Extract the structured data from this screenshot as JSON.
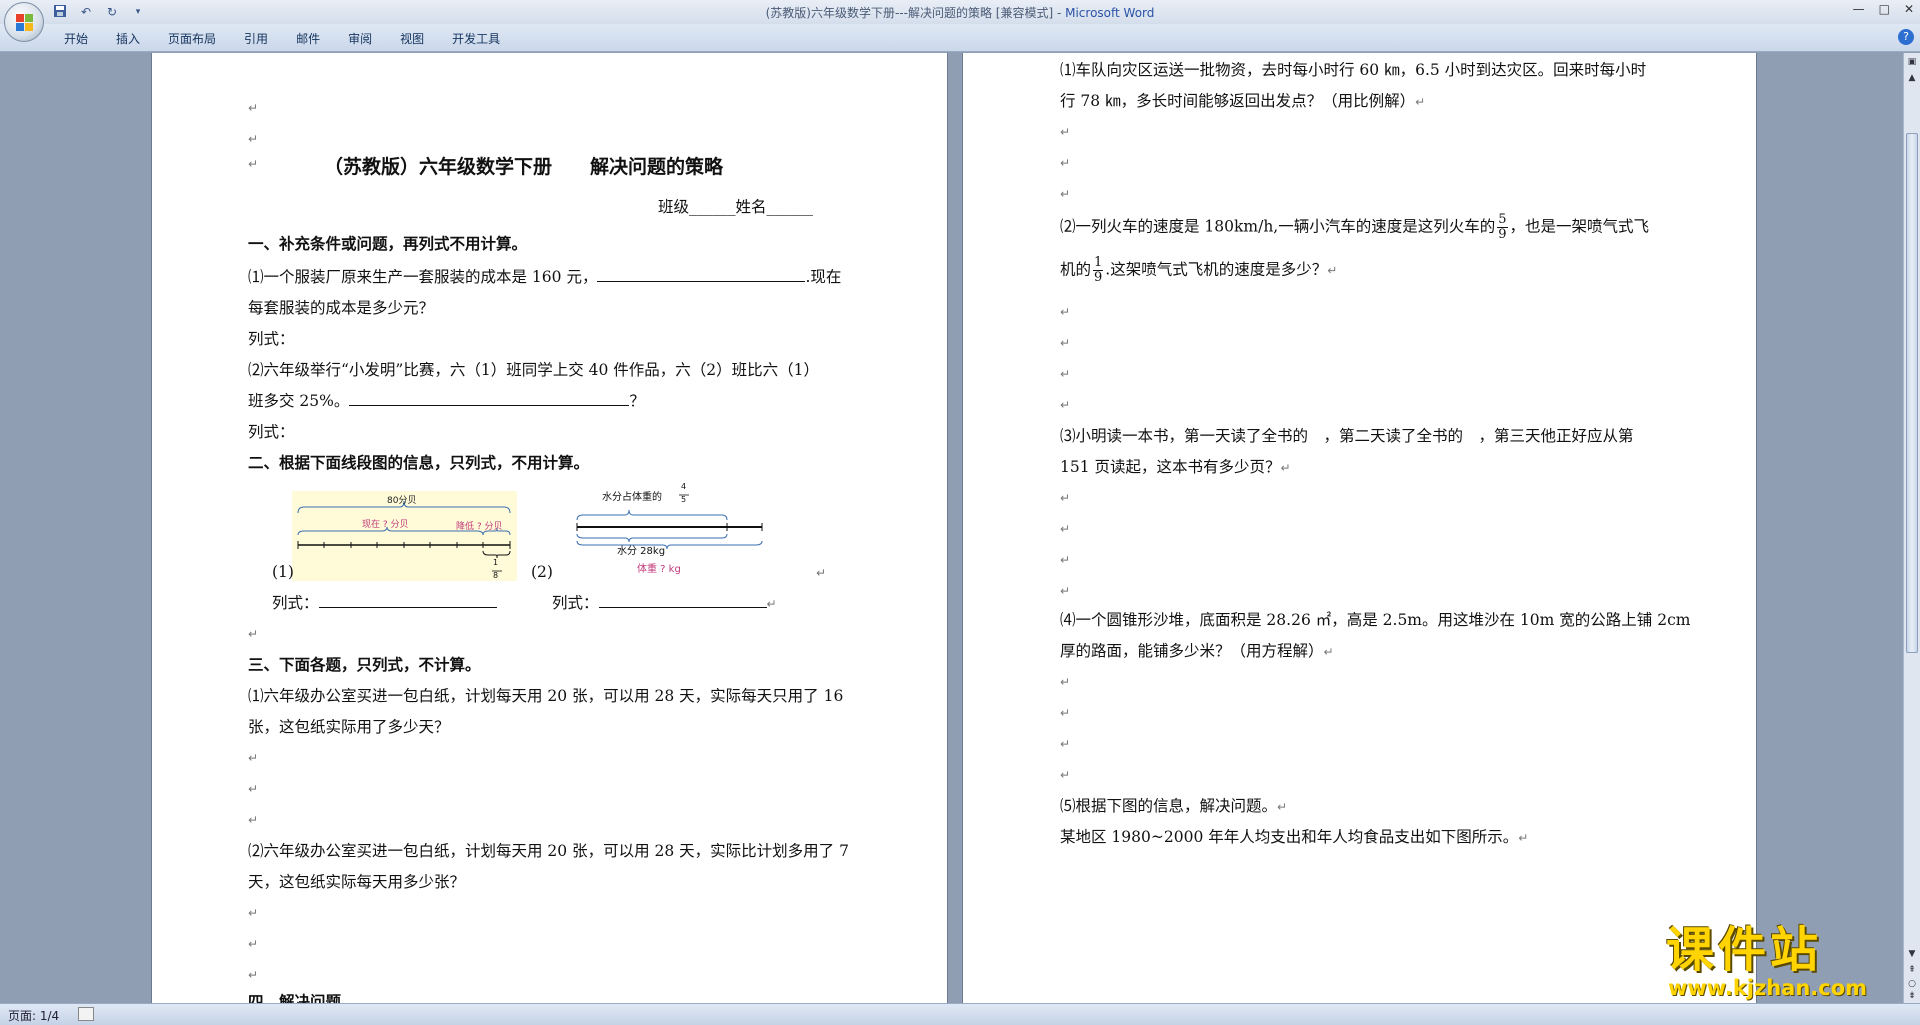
{
  "window": {
    "title_doc": "(苏教版)六年级数学下册---解决问题的策略 [兼容模式] - ",
    "title_app": "Microsoft Word"
  },
  "ribbon": {
    "tabs": [
      "开始",
      "插入",
      "页面布局",
      "引用",
      "邮件",
      "审阅",
      "视图",
      "开发工具"
    ]
  },
  "paragraph_mark": "↵",
  "left_page": {
    "title": "（苏教版）六年级数学下册　　解决问题的策略",
    "class_name_line": "班级______姓名______",
    "section1": "一、补充条件或问题，再列式不用计算。",
    "q1_1a": "⑴一个服装厂原来生产一套服装的成本是 160 元，",
    "q1_1b": ".现在",
    "q1_1c": "每套服装的成本是多少元？",
    "formula": "列式：",
    "q1_2a": "⑵六年级举行“小发明”比赛，六（1）班同学上交 40 件作品，六（2）班比六（1）",
    "q1_2b": "班多交 25%。",
    "q1_2c": "？",
    "section2": "二、根据下面线段图的信息，只列式，不用计算。",
    "fig1_label": "(1)",
    "fig2_label": "(2)",
    "fig1": {
      "top": "80分贝",
      "now": "现在 ? 分贝",
      "drop": "降低 ? 分贝",
      "frac_num": "1",
      "frac_den": "8"
    },
    "fig2": {
      "water_label": "水分占体重的",
      "frac_num": "4",
      "frac_den": "5",
      "water": "水分 28kg",
      "weight": "体重 ? kg"
    },
    "section3": "三、下面各题，只列式，不计算。",
    "q3_1a": "⑴六年级办公室买进一包白纸，计划每天用 20 张，可以用 28 天，实际每天只用了 16",
    "q3_1b": "张，这包纸实际用了多少天？",
    "q3_2a": "⑵六年级办公室买进一包白纸，计划每天用 20 张，可以用 28 天，实际比计划多用了 7",
    "q3_2b": "天，这包纸实际每天用多少张？",
    "section4": "四、解决问题"
  },
  "right_page": {
    "r1a": "⑴车队向灾区运送一批物资，去时每小时行 60 ㎞，6.5 小时到达灾区。回来时每小时",
    "r1b": "行 78 ㎞，多长时间能够返回出发点？（用比例解）",
    "r2a": "⑵一列火车的速度是 180km/h,一辆小汽车的速度是这列火车的",
    "r2_frac1": {
      "num": "5",
      "den": "9"
    },
    "r2b": "，也是一架喷气式飞",
    "r2c": "机的",
    "r2_frac2": {
      "num": "1",
      "den": "9"
    },
    "r2d": ".这架喷气式飞机的速度是多少？",
    "r3a": "⑶小明读一本书，第一天读了全书的　，第二天读了全书的　，第三天他正好应从第",
    "r3b": "151 页读起，这本书有多少页？",
    "r4a": "⑷一个圆锥形沙堆，底面积是 28.26 ㎡，高是 2.5m。用这堆沙在 10m 宽的公路上铺 2cm",
    "r4b": "厚的路面，能铺多少米？（用方程解）",
    "r5": "⑸根据下图的信息，解决问题。",
    "r5b": "某地区 1980~2000 年年人均支出和年人均食品支出如下图所示。"
  },
  "statusbar": {
    "page": "页面: 1/4"
  },
  "watermark": {
    "big": "课件站",
    "url": "www.kjzhan.com"
  }
}
